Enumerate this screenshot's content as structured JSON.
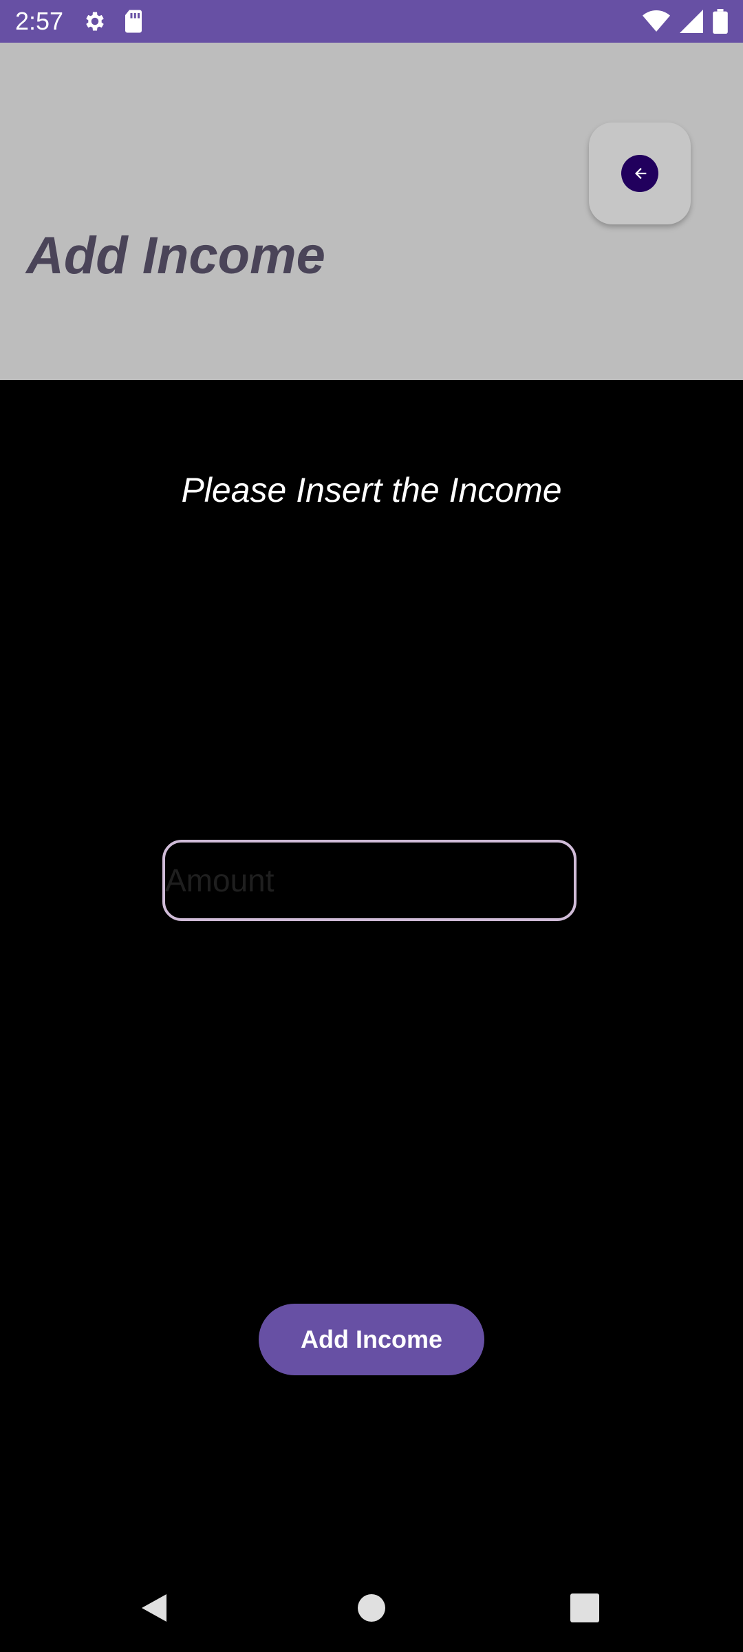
{
  "status_bar": {
    "time": "2:57",
    "icons": [
      "settings-icon",
      "sd-card-icon",
      "wifi-icon",
      "signal-icon",
      "battery-icon"
    ]
  },
  "header": {
    "title": "Add Income",
    "back_button_icon": "arrow-left-icon"
  },
  "sheet": {
    "title": "Please Insert the Income",
    "amount": {
      "value": "",
      "placeholder": "Amount"
    },
    "submit_label": "Add Income"
  },
  "nav_bar": {
    "icons": [
      "back-icon",
      "home-icon",
      "recents-icon"
    ]
  },
  "colors": {
    "primary": "#6750a4",
    "header_bg": "#bdbdbd",
    "title_text": "#4a4458",
    "sheet_bg": "#000000",
    "input_border": "#d0bcd8",
    "back_circle": "#21005d"
  }
}
